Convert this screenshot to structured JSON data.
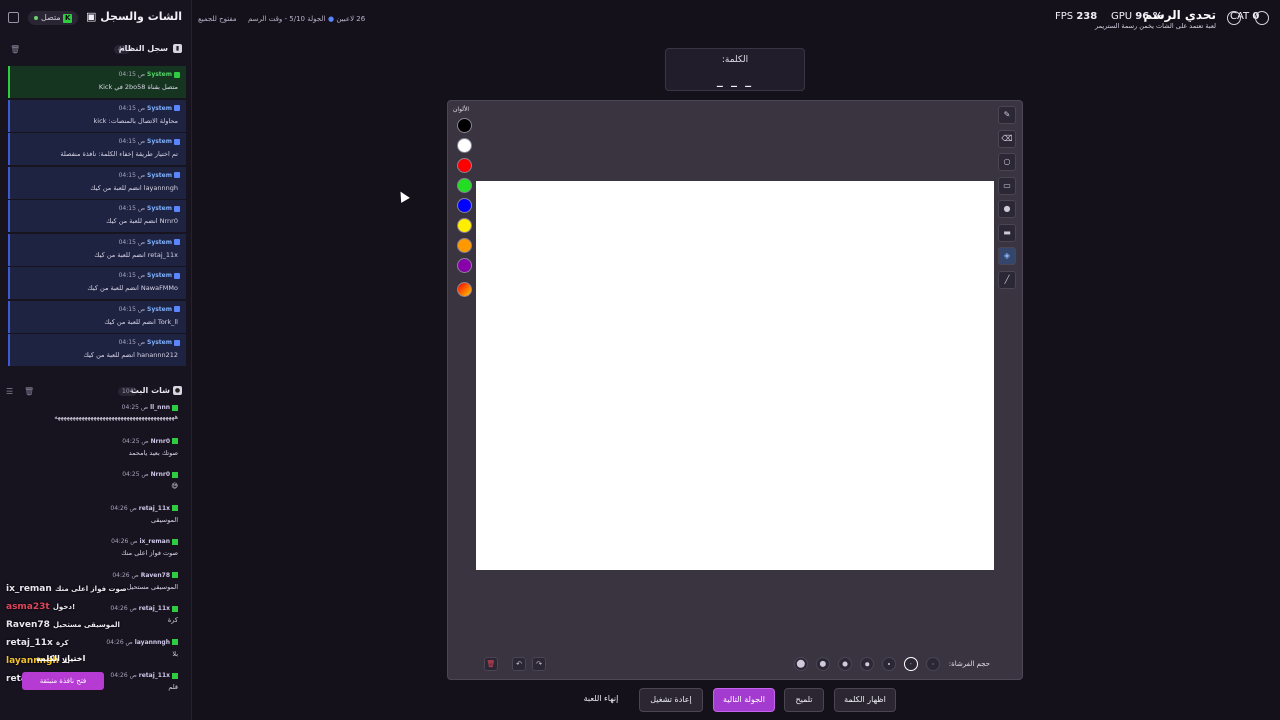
{
  "sidebar": {
    "title": "الشات والسجل",
    "status": "متصل",
    "log_section": {
      "title": "سجل النظام",
      "count": "41"
    },
    "log_entries": [
      {
        "time": "04:15 ص",
        "user": "System",
        "text": "متصل بقناة 2bo58 في Kick"
      },
      {
        "time": "04:15 ص",
        "user": "System",
        "text": "محاولة الاتصال بالمنصات: kick"
      },
      {
        "time": "04:15 ص",
        "user": "System",
        "text": "تم اختيار طريقة إخفاء الكلمة: نافذة منفصلة"
      },
      {
        "time": "04:15 ص",
        "user": "System",
        "text": "layannngh انضم للعبة من كيك"
      },
      {
        "time": "04:15 ص",
        "user": "System",
        "text": "Nrnr0 انضم للعبة من كيك"
      },
      {
        "time": "04:15 ص",
        "user": "System",
        "text": "retaj_11x انضم للعبة من كيك"
      },
      {
        "time": "04:15 ص",
        "user": "System",
        "text": "NawaFMMo انضم للعبة من كيك"
      },
      {
        "time": "04:15 ص",
        "user": "System",
        "text": "Tork_ll انضم للعبة من كيك"
      },
      {
        "time": "04:15 ص",
        "user": "System",
        "text": "hanannn212 انضم للعبة من كيك"
      }
    ],
    "chat_section": {
      "title": "شات البث",
      "count": "104"
    },
    "chat_messages": [
      {
        "time": "04:25 ص",
        "user": "ll_nnn",
        "text": "ههههههههههههههههههههههههههههههههههههههههه"
      },
      {
        "time": "04:25 ص",
        "user": "Nrnr0",
        "text": "صوتك بعيد يامحمد"
      },
      {
        "time": "04:25 ص",
        "user": "Nrnr0",
        "text": "😅"
      },
      {
        "time": "04:26 ص",
        "user": "retaj_11x",
        "text": "الموسيقى"
      },
      {
        "time": "04:26 ص",
        "user": "ix_reman",
        "text": "صوت فواز اعلى منك"
      },
      {
        "time": "04:26 ص",
        "user": "Raven78",
        "text": "الموسيقى مستحيل"
      },
      {
        "time": "04:26 ص",
        "user": "retaj_11x",
        "text": "كرة"
      },
      {
        "time": "04:26 ص",
        "user": "layannngh",
        "text": "بلا"
      },
      {
        "time": "04:26 ص",
        "user": "retaj_11x",
        "text": "قلم"
      }
    ]
  },
  "overlay": {
    "lines": [
      {
        "user": "ix_reman",
        "text": "صوت فواز اعلى منك",
        "color": "#e8e6ee"
      },
      {
        "user": "asma23t",
        "text": "دخول!",
        "color": "#e0455b"
      },
      {
        "user": "Raven78",
        "text": "الموسيقى مستحيل",
        "color": "#e8e6ee"
      },
      {
        "user": "retaj_11x",
        "text": "كرة",
        "color": "#e8e6ee"
      },
      {
        "user": "layannngh",
        "text": "بلا",
        "color": "#f2c12e"
      },
      {
        "user": "retaj_11x",
        "text": "قلم",
        "color": "#e8e6ee"
      }
    ],
    "choose_word": "اختيار الكلمة",
    "open_window": "فتح نافذة منبثقة"
  },
  "topbar": {
    "players": "26 لاعبين",
    "round": "الجولة 5/10 - وقت الرسم",
    "mode": "مفتوح للجميع",
    "fps_label": "FPS",
    "fps_value": "238",
    "gpu_label": "GPU",
    "gpu_value": "96 %",
    "cpu_label": "CAT",
    "cpu_value": "0",
    "streamer_name": "تحدي الرسم",
    "streamer_sub": "لعبة تعتمد على الشات يخمن رسمة الستريمر"
  },
  "word_card": {
    "label": "الكلمة:",
    "blanks": "_ _ _"
  },
  "board": {
    "palette_title": "الألوان",
    "colors": [
      "#000000",
      "#ffffff",
      "#ff0000",
      "#22dd22",
      "#0000ff",
      "#ffee00",
      "#ff9900",
      "#8800aa"
    ],
    "tools": [
      "pencil-icon",
      "eraser-icon",
      "circle-icon",
      "rectangle-icon",
      "filled-circle-icon",
      "filled-rect-icon",
      "fill-icon",
      "line-icon"
    ],
    "active_tool": "fill-icon",
    "brush_size_label": "حجم الفرشاة:",
    "brush_sizes": [
      12,
      9,
      7,
      5,
      3,
      2,
      1
    ],
    "selected_brush_index": 5
  },
  "buttons": {
    "end_game": "إنهاء اللعبة",
    "restart": "إعادة تشغيل",
    "next_round": "الجولة التالية",
    "hint": "تلميح",
    "show_word": "اظهار الكلمة"
  }
}
